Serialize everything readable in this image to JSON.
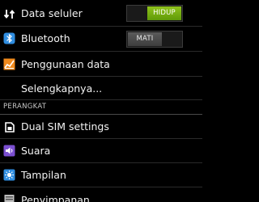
{
  "settings": {
    "data": {
      "label": "Data seluler",
      "icon": "data-arrows-icon",
      "toggle": "HIDUP"
    },
    "bluetooth": {
      "label": "Bluetooth",
      "icon": "bluetooth-icon",
      "toggle": "MATI"
    },
    "data_usage": {
      "label": "Penggunaan data",
      "icon": "data-usage-chart-icon"
    },
    "more": {
      "label": "Selengkapnya..."
    },
    "device_section": {
      "header": "PERANGKAT"
    },
    "dual_sim": {
      "label": "Dual SIM settings",
      "icon": "sim-card-icon"
    },
    "sound": {
      "label": "Suara",
      "icon": "speaker-icon"
    },
    "display": {
      "label": "Tampilan",
      "icon": "display-brightness-icon"
    },
    "storage": {
      "label": "Penyimpanan",
      "icon": "storage-icon"
    }
  },
  "colors": {
    "toggle_on": "#7ab317",
    "toggle_off": "#4a4a4a",
    "bluetooth_icon": "#2f8de0",
    "data_usage_icon": "#f08a1c",
    "sound_icon": "#7b4fd0",
    "display_icon": "#2f8de0"
  }
}
